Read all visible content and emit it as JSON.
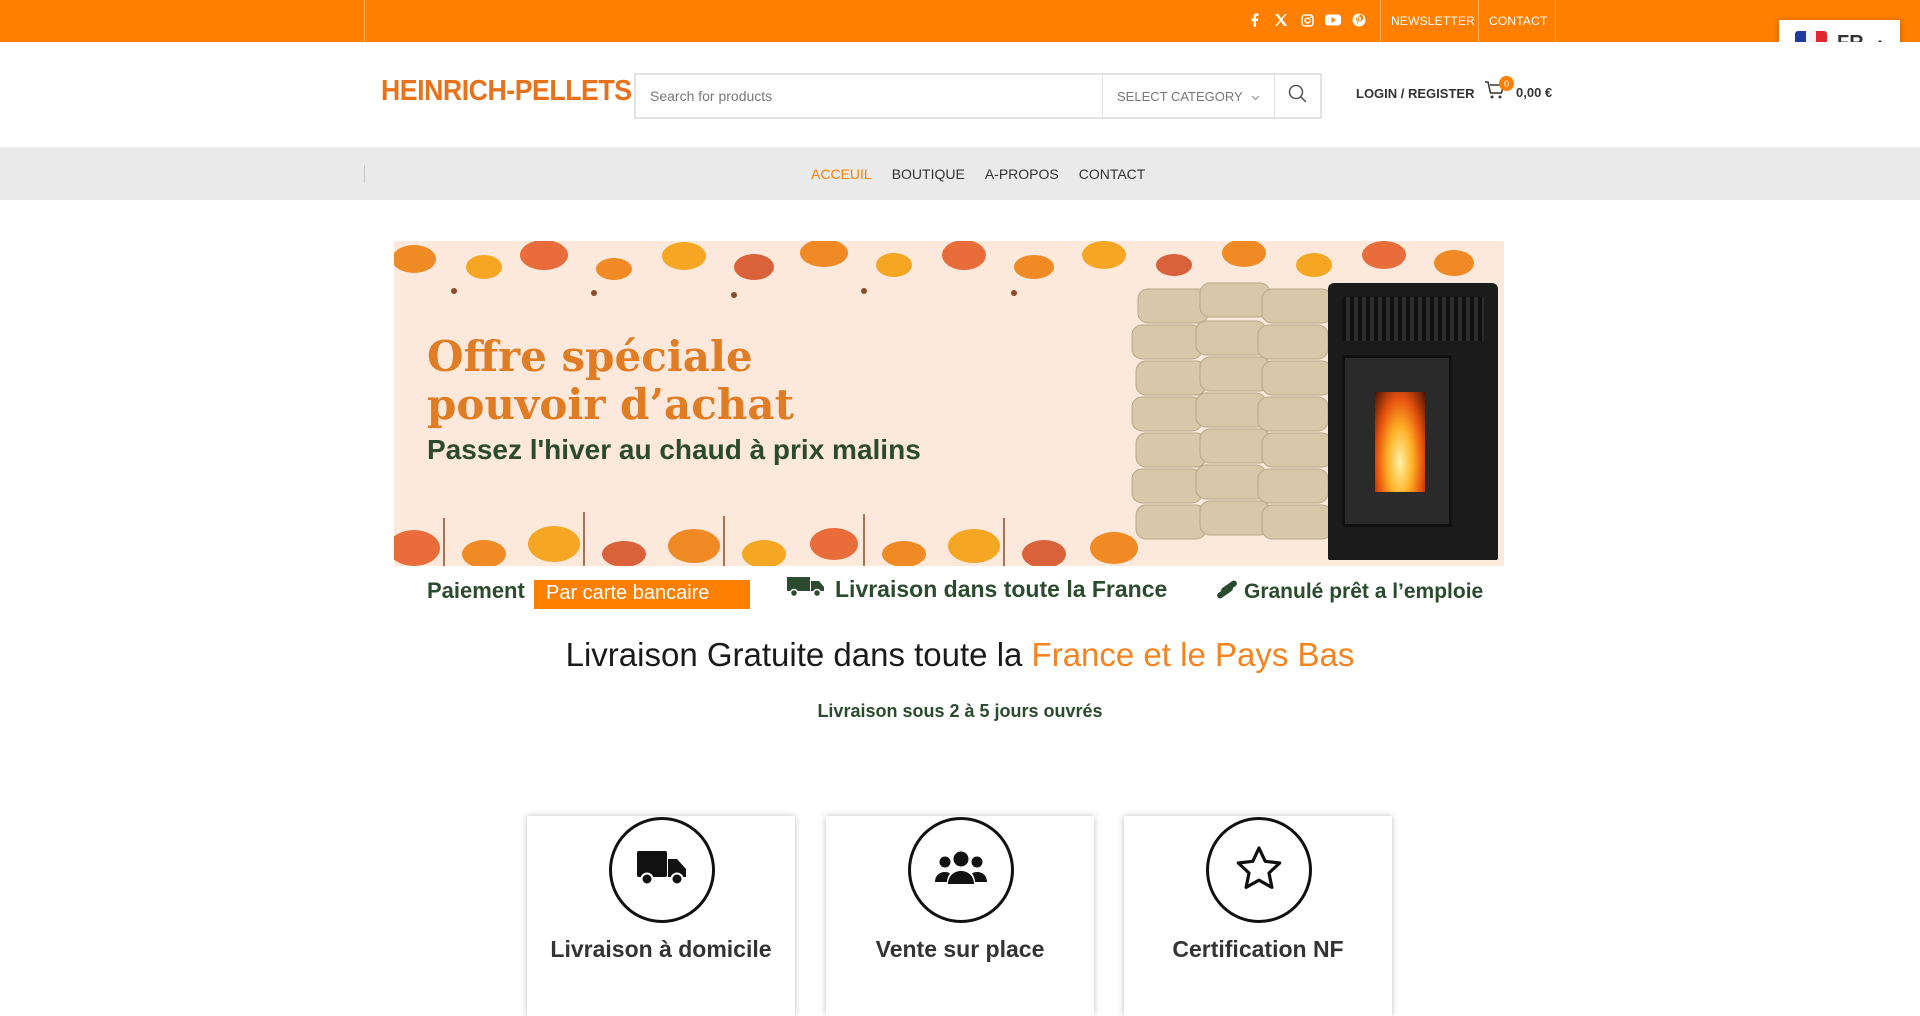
{
  "topbar": {
    "links": [
      "NEWSLETTER",
      "CONTACT"
    ],
    "social_icons": [
      "facebook-icon",
      "x-icon",
      "instagram-icon",
      "youtube-icon",
      "pinterest-icon"
    ],
    "color": "#ff7f00"
  },
  "language": {
    "code": "FR"
  },
  "header": {
    "logo": "HEINRICH-PELLETS",
    "search_placeholder": "Search for products",
    "category_label": "SELECT CATEGORY",
    "login_label": "LOGIN / REGISTER",
    "cart_count": "0",
    "cart_total": "0,00 €"
  },
  "nav": {
    "items": [
      "ACCEUIL",
      "BOUTIQUE",
      "A-PROPOS",
      "CONTACT"
    ],
    "active_index": 0
  },
  "banner": {
    "headline_line1": "Offre spéciale",
    "headline_line2": "pouvoir d’achat",
    "tagline": "Passez l'hiver au chaud à prix malins"
  },
  "features": {
    "payment_label": "Paiement",
    "payment_method": "Par carte bancaire",
    "delivery": "Livraison dans toute la France",
    "pellet": "Granulé prêt a l’emploie"
  },
  "section": {
    "title_prefix": "Livraison Gratuite dans toute la ",
    "title_accent": "France et le Pays Bas",
    "subtitle": "Livraison sous 2 à 5 jours ouvrés"
  },
  "cards": [
    {
      "label": "Livraison à domicile",
      "icon": "truck-icon"
    },
    {
      "label": "Vente sur place",
      "icon": "users-icon"
    },
    {
      "label": "Certification NF",
      "icon": "star-icon"
    }
  ]
}
